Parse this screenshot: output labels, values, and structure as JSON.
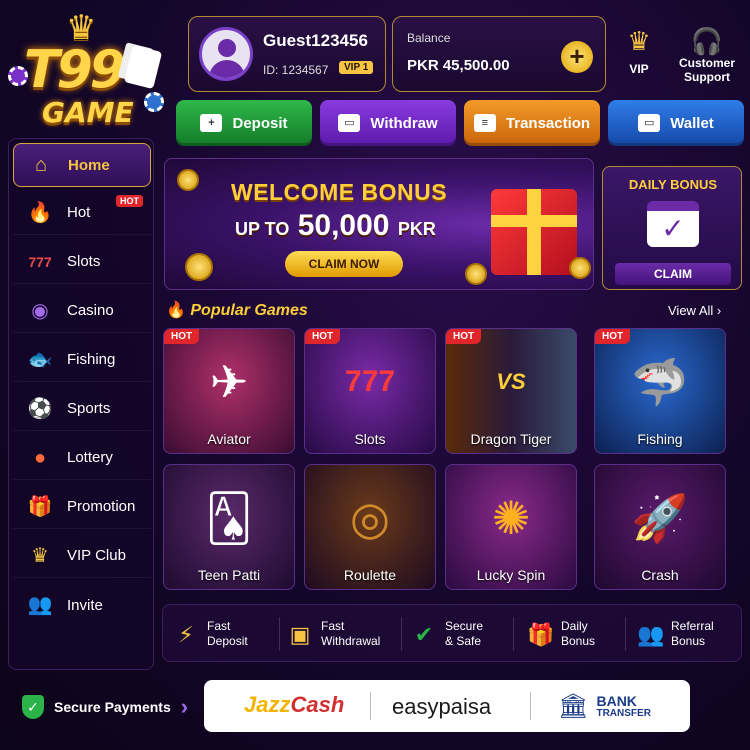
{
  "logo": {
    "line1": "T99",
    "line2": "GAME"
  },
  "user": {
    "name": "Guest123456",
    "id": "ID: 1234567",
    "vip": "VIP 1"
  },
  "balance": {
    "label": "Balance",
    "value": "PKR 45,500.00",
    "add": "+"
  },
  "top_links": {
    "vip": "VIP",
    "support": "Customer Support"
  },
  "actions": {
    "deposit": "Deposit",
    "withdraw": "Withdraw",
    "transaction": "Transaction",
    "wallet": "Wallet"
  },
  "sidebar": {
    "items": [
      {
        "label": "Home",
        "icon": "home-icon"
      },
      {
        "label": "Hot",
        "icon": "fire-icon",
        "tag": "HOT"
      },
      {
        "label": "Slots",
        "icon": "slot-machine-icon"
      },
      {
        "label": "Casino",
        "icon": "chip-icon"
      },
      {
        "label": "Fishing",
        "icon": "fish-icon"
      },
      {
        "label": "Sports",
        "icon": "soccer-ball-icon"
      },
      {
        "label": "Lottery",
        "icon": "lottery-balls-icon"
      },
      {
        "label": "Promotion",
        "icon": "gift-icon"
      },
      {
        "label": "VIP Club",
        "icon": "crown-icon"
      },
      {
        "label": "Invite",
        "icon": "users-icon"
      }
    ]
  },
  "banner": {
    "title": "WELCOME BONUS",
    "sub_prefix": "UP TO",
    "amount": "50,000",
    "currency": "PKR",
    "cta": "CLAIM NOW"
  },
  "daily_bonus": {
    "title": "DAILY BONUS",
    "cta": "CLAIM"
  },
  "popular": {
    "heading": "Popular Games",
    "view_all": "View All",
    "games": [
      {
        "title": "Aviator",
        "tag": "HOT"
      },
      {
        "title": "Slots",
        "tag": "HOT"
      },
      {
        "title": "Dragon Tiger",
        "tag": "HOT"
      },
      {
        "title": "Fishing",
        "tag": "HOT"
      },
      {
        "title": "Teen Patti",
        "tag": ""
      },
      {
        "title": "Roulette",
        "tag": ""
      },
      {
        "title": "Lucky Spin",
        "tag": ""
      },
      {
        "title": "Crash",
        "tag": ""
      }
    ]
  },
  "features": [
    {
      "l1": "Fast",
      "l2": "Deposit",
      "icon": "lightning-icon"
    },
    {
      "l1": "Fast",
      "l2": "Withdrawal",
      "icon": "wallet-icon"
    },
    {
      "l1": "Secure",
      "l2": "& Safe",
      "icon": "shield-check-icon"
    },
    {
      "l1": "Daily",
      "l2": "Bonus",
      "icon": "gift-icon"
    },
    {
      "l1": "Referral",
      "l2": "Bonus",
      "icon": "add-user-icon"
    }
  ],
  "footer": {
    "secure_label": "Secure Payments",
    "jazz_a": "Jazz",
    "jazz_b": "Cash",
    "easypaisa": "easypaisa",
    "bank_1": "BANK",
    "bank_2": "TRANSFER"
  },
  "colors": {
    "accent_gold": "#f5c542",
    "hot_red": "#e0252b",
    "bg_purple": "#14062a"
  }
}
